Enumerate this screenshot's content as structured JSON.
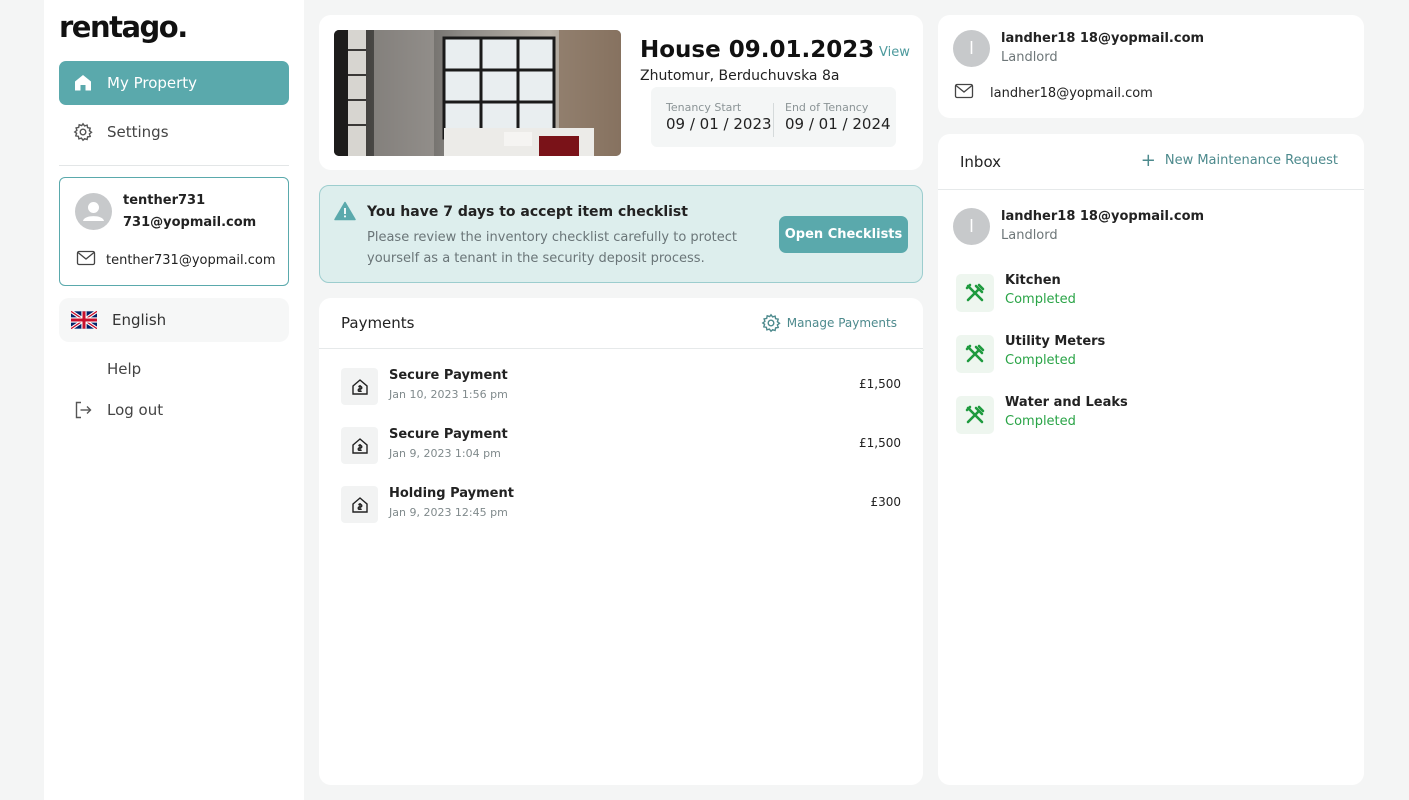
{
  "brand": {
    "logo": "rentago."
  },
  "sidebar": {
    "nav": [
      {
        "label": "My Property",
        "icon": "home-icon"
      },
      {
        "label": "Settings",
        "icon": "gear-icon"
      }
    ],
    "user": {
      "name": "tenther731 731@yopmail.com",
      "email": "tenther731@yopmail.com"
    },
    "language": "English",
    "help": "Help",
    "logout": "Log out"
  },
  "property": {
    "title": "House 09.01.2023",
    "view": "View",
    "address": "Zhutomur, Berduchuvska 8a",
    "tenancy_start_label": "Tenancy Start",
    "tenancy_start": "09 / 01 / 2023",
    "tenancy_end_label": "End of Tenancy",
    "tenancy_end": "09 / 01 / 2024"
  },
  "alert": {
    "title": "You have 7 days to accept item checklist",
    "text": "Please review the inventory checklist carefully to protect yourself as a tenant in the security deposit process.",
    "button": "Open Checklists"
  },
  "payments": {
    "title": "Payments",
    "manage": "Manage Payments",
    "items": [
      {
        "name": "Secure Payment",
        "date": "Jan 10, 2023 1:56 pm",
        "amount": "£1,500"
      },
      {
        "name": "Secure Payment",
        "date": "Jan 9, 2023 1:04 pm",
        "amount": "£1,500"
      },
      {
        "name": "Holding Payment",
        "date": "Jan 9, 2023 12:45 pm",
        "amount": "£300"
      }
    ]
  },
  "landlord": {
    "initial": "l",
    "name": "landher18 18@yopmail.com",
    "role": "Landlord",
    "email": "landher18@yopmail.com"
  },
  "inbox": {
    "title": "Inbox",
    "new_request": "New Maintenance Request",
    "contact": {
      "initial": "l",
      "name": "landher18 18@yopmail.com",
      "role": "Landlord"
    },
    "tasks": [
      {
        "name": "Kitchen",
        "status": "Completed"
      },
      {
        "name": "Utility Meters",
        "status": "Completed"
      },
      {
        "name": "Water and Leaks",
        "status": "Completed"
      }
    ]
  },
  "colors": {
    "accent": "#5aa9ac",
    "success": "#2aa447",
    "alert_bg": "#ddeeed"
  }
}
